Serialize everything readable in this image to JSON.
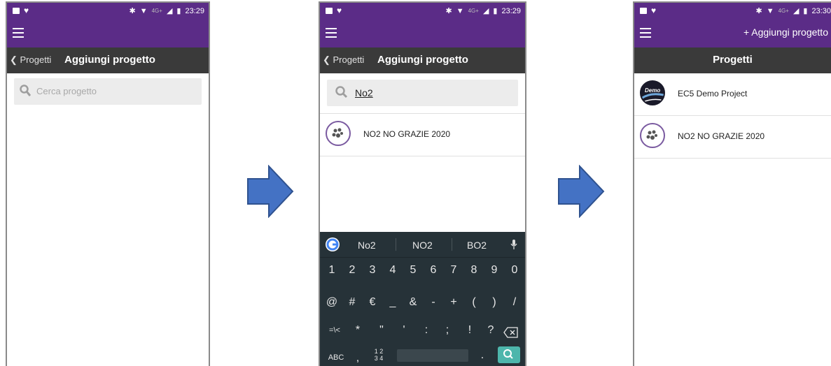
{
  "colors": {
    "appbar": "#5b2c87",
    "navbar": "#3a3a3a",
    "keyboard": "#263238",
    "arrow": "#4472c4",
    "search_key": "#4db6ac"
  },
  "status": {
    "time1": "23:29",
    "time2": "23:29",
    "time3": "23:30",
    "network": "4G+"
  },
  "screen1": {
    "back_label": "Progetti",
    "title": "Aggiungi progetto",
    "search_placeholder": "Cerca progetto"
  },
  "screen2": {
    "back_label": "Progetti",
    "title": "Aggiungi progetto",
    "search_value": "No2",
    "results": [
      {
        "label": "NO2 NO GRAZIE 2020"
      }
    ],
    "keyboard": {
      "suggestions": [
        "No2",
        "NO2",
        "BO2"
      ],
      "row1": [
        "1",
        "2",
        "3",
        "4",
        "5",
        "6",
        "7",
        "8",
        "9",
        "0"
      ],
      "row2": [
        "@",
        "#",
        "€",
        "_",
        "&",
        "-",
        "+",
        "(",
        ")",
        "/"
      ],
      "row3": [
        "=\\<",
        "*",
        "\"",
        "'",
        ":",
        ";",
        "!",
        "?"
      ],
      "abc_label": "ABC",
      "comma": ",",
      "numpad_label_top": "1 2",
      "numpad_label_bottom": "3 4",
      "period": "."
    }
  },
  "screen3": {
    "add_label": "Aggiungi progetto",
    "title": "Progetti",
    "projects": [
      {
        "label": "EC5 Demo Project",
        "icon_text": "Demo"
      },
      {
        "label": "NO2 NO GRAZIE 2020"
      }
    ]
  }
}
